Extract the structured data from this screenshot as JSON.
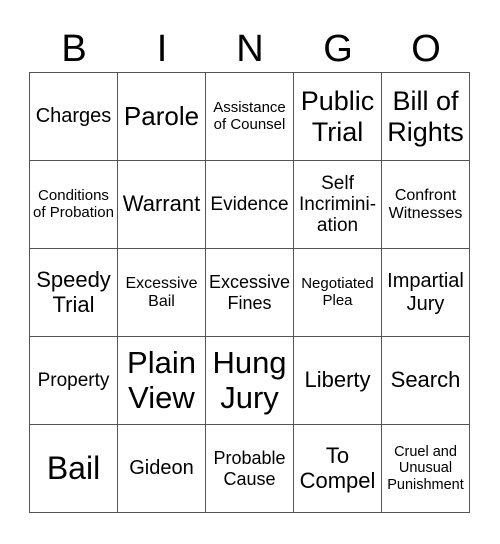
{
  "header": {
    "letters": [
      "B",
      "I",
      "N",
      "G",
      "O"
    ]
  },
  "grid": {
    "rows": [
      [
        "Charges",
        "Parole",
        "Assistance of Counsel",
        "Public Trial",
        "Bill of Rights"
      ],
      [
        "Conditions of Probation",
        "Warrant",
        "Evidence",
        "Self Incrimini- ation",
        "Confront Witnesses"
      ],
      [
        "Speedy Trial",
        "Excessive Bail",
        "Excessive Fines",
        "Negotiated Plea",
        "Impartial Jury"
      ],
      [
        "Property",
        "Plain View",
        "Hung Jury",
        "Liberty",
        "Search"
      ],
      [
        "Bail",
        "Gideon",
        "Probable Cause",
        "To Compel",
        "Cruel and Unusual Punishment"
      ]
    ]
  }
}
